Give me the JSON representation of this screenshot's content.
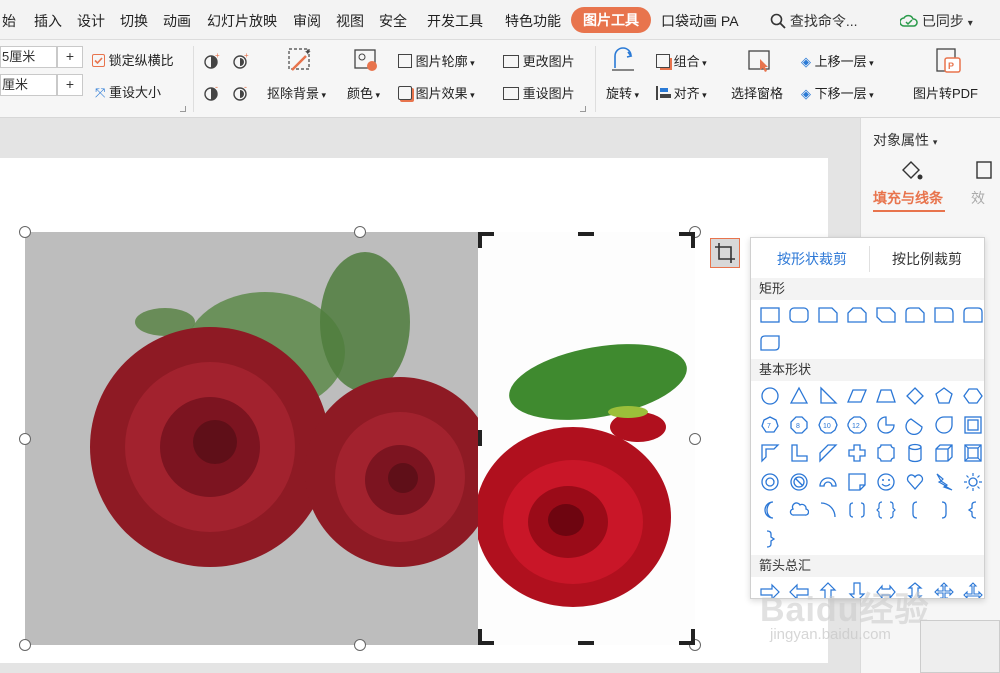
{
  "menu": {
    "items": [
      "始",
      "插入",
      "设计",
      "切换",
      "动画",
      "幻灯片放映",
      "审阅",
      "视图",
      "安全",
      "开发工具",
      "特色功能",
      "图片工具",
      "口袋动画 PA"
    ],
    "active": "图片工具",
    "search": "查找命令...",
    "sync": "已同步"
  },
  "ribbon": {
    "height_value": "5厘米",
    "width_value": "厘米",
    "lock_ratio": "锁定纵横比",
    "reset_size": "重设大小",
    "remove_bg": "抠除背景",
    "color": "颜色",
    "pic_outline": "图片轮廓",
    "pic_effect": "图片效果",
    "change_pic": "更改图片",
    "reset_pic": "重设图片",
    "rotate": "旋转",
    "group": "组合",
    "align": "对齐",
    "select_pane": "选择窗格",
    "bring_forward": "上移一层",
    "send_backward": "下移一层",
    "pic_to_pdf": "图片转PDF"
  },
  "right_panel": {
    "title": "对象属性",
    "tab_fill": "填充与线条",
    "tab_effect": "效"
  },
  "crop_popup": {
    "tab_shape": "按形状裁剪",
    "tab_ratio": "按比例裁剪",
    "sec_rect": "矩形",
    "sec_basic": "基本形状",
    "sec_arrows": "箭头总汇"
  },
  "watermark": {
    "brand": "Baidu经验",
    "url": "jingyan.baidu.com"
  },
  "colors": {
    "accent": "#e8744d",
    "link": "#2b77d6"
  }
}
